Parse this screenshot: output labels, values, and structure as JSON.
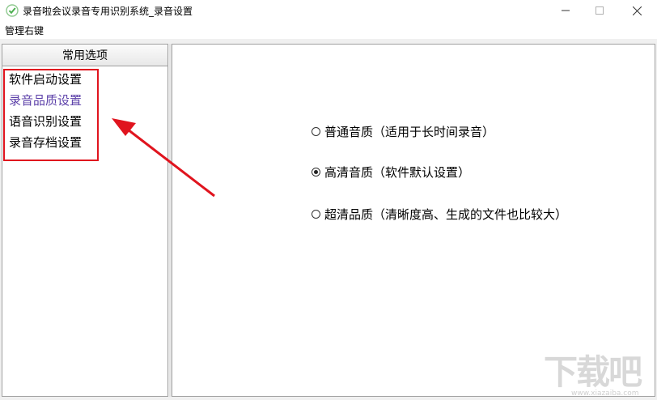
{
  "window": {
    "title": "录音啦会议录音专用识别系统_录音设置",
    "controls": [
      "minimize-icon",
      "maximize-icon",
      "close-icon"
    ]
  },
  "menubar": {
    "item": "管理右键"
  },
  "sidebar": {
    "header": "常用选项",
    "items": [
      {
        "label": "软件启动设置",
        "active": false
      },
      {
        "label": "录音品质设置",
        "active": true
      },
      {
        "label": "语音识别设置",
        "active": false
      },
      {
        "label": "录音存档设置",
        "active": false
      }
    ]
  },
  "quality_options": [
    {
      "label": "普通音质（适用于长时间录音）",
      "selected": false
    },
    {
      "label": "高清音质（软件默认设置）",
      "selected": true
    },
    {
      "label": "超清品质（清晰度高、生成的文件也比较大）",
      "selected": false
    }
  ],
  "watermark": {
    "text": "下载吧",
    "url": "www.xiazaiba.com"
  },
  "colors": {
    "active_item": "#5b3fa8",
    "annotation_red": "#e0141e",
    "app_icon_green": "#5cb85c"
  }
}
